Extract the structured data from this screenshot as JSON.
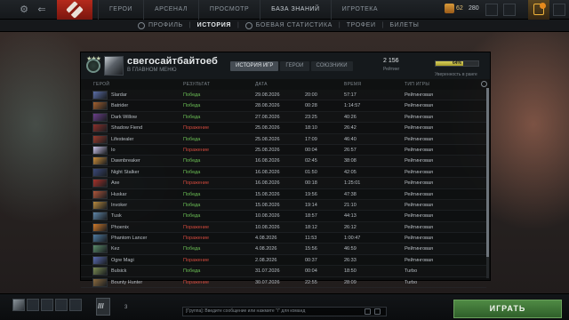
{
  "topbar": {
    "nav": [
      {
        "label": "ГЕРОИ",
        "active": false
      },
      {
        "label": "АРСЕНАЛ",
        "active": false
      },
      {
        "label": "ПРОСМОТР",
        "active": false
      },
      {
        "label": "БАЗА ЗНАНИЙ",
        "active": true
      },
      {
        "label": "ИГРОТЕКА",
        "active": false
      }
    ],
    "shards": "62",
    "level": "280",
    "icons": [
      "gear-icon",
      "back-arrow-icon",
      "dota-logo",
      "treasure-chest-icon",
      "store-icon",
      "notification-icon",
      "ranking-icon",
      "power-icon"
    ]
  },
  "subnav": {
    "items": [
      {
        "label": "ПРОФИЛЬ",
        "active": false
      },
      {
        "label": "ИСТОРИЯ",
        "active": true
      },
      {
        "label": "БОЕВАЯ СТАТИСТИКА",
        "active": false
      },
      {
        "label": "ТРОФЕИ",
        "active": false
      },
      {
        "label": "БИЛЕТЫ",
        "active": false
      }
    ]
  },
  "profile": {
    "name": "свегосайтбайтоеб",
    "status": "В ГЛАВНОМ МЕНЮ",
    "tabs": [
      {
        "label": "ИСТОРИЯ ИГР",
        "active": true
      },
      {
        "label": "ГЕРОИ",
        "active": false
      },
      {
        "label": "СОЮЗНИКИ",
        "active": false
      }
    ],
    "rating_value": "2 156",
    "rating_label": "Рейтинг",
    "winrate_value": "64%",
    "winrate_fraction": 0.64,
    "winrate_label": "Уверенность в ранге"
  },
  "table": {
    "headers": {
      "hero": "ГЕРОЙ",
      "result": "РЕЗУЛЬТАТ",
      "date": "ДАТА",
      "duration": "ВРЕМЯ",
      "type": "ТИП ИГРЫ"
    },
    "rows": [
      {
        "hero": "Slardar",
        "result": "Победа",
        "win": true,
        "date": "29.08.2026",
        "time": "20:00",
        "duration": "57:17",
        "type": "Рейтинговая",
        "color": "#5b6ea8"
      },
      {
        "hero": "Batrider",
        "result": "Победа",
        "win": true,
        "date": "28.08.2026",
        "time": "00:28",
        "duration": "1:14:57",
        "type": "Рейтинговая",
        "color": "#a4602e"
      },
      {
        "hero": "Dark Willow",
        "result": "Победа",
        "win": true,
        "date": "27.08.2026",
        "time": "23:25",
        "duration": "40:26",
        "type": "Рейтинговая",
        "color": "#6b3e8a"
      },
      {
        "hero": "Shadow Fiend",
        "result": "Поражение",
        "win": false,
        "date": "25.08.2026",
        "time": "18:10",
        "duration": "26:42",
        "type": "Рейтинговая",
        "color": "#8b2f2a"
      },
      {
        "hero": "Lifestealer",
        "result": "Победа",
        "win": true,
        "date": "25.08.2026",
        "time": "17:09",
        "duration": "46:40",
        "type": "Рейтинговая",
        "color": "#9a3a2c"
      },
      {
        "hero": "Io",
        "result": "Поражение",
        "win": false,
        "date": "25.08.2026",
        "time": "00:04",
        "duration": "26:57",
        "type": "Рейтинговая",
        "color": "#c9c2e8"
      },
      {
        "hero": "Dawnbreaker",
        "result": "Победа",
        "win": true,
        "date": "16.08.2026",
        "time": "02:45",
        "duration": "38:08",
        "type": "Рейтинговая",
        "color": "#c98d3a"
      },
      {
        "hero": "Night Stalker",
        "result": "Победа",
        "win": true,
        "date": "16.08.2026",
        "time": "01:50",
        "duration": "42:05",
        "type": "Рейтинговая",
        "color": "#3b4a7a"
      },
      {
        "hero": "Axe",
        "result": "Поражение",
        "win": false,
        "date": "16.08.2026",
        "time": "00:18",
        "duration": "1:25:01",
        "type": "Рейтинговая",
        "color": "#a8322a"
      },
      {
        "hero": "Huskar",
        "result": "Победа",
        "win": true,
        "date": "15.08.2026",
        "time": "19:56",
        "duration": "47:38",
        "type": "Рейтинговая",
        "color": "#b0563a"
      },
      {
        "hero": "Invoker",
        "result": "Победа",
        "win": true,
        "date": "15.08.2026",
        "time": "19:14",
        "duration": "21:10",
        "type": "Рейтинговая",
        "color": "#b88a3e"
      },
      {
        "hero": "Tusk",
        "result": "Победа",
        "win": true,
        "date": "10.08.2026",
        "time": "18:57",
        "duration": "44:13",
        "type": "Рейтинговая",
        "color": "#5f86a8"
      },
      {
        "hero": "Phoenix",
        "result": "Поражение",
        "win": false,
        "date": "10.08.2026",
        "time": "18:12",
        "duration": "26:12",
        "type": "Рейтинговая",
        "color": "#d07a2a"
      },
      {
        "hero": "Phantom Lancer",
        "result": "Поражение",
        "win": false,
        "date": "4.08.2026",
        "time": "11:53",
        "duration": "1:00:47",
        "type": "Рейтинговая",
        "color": "#4e7aa0"
      },
      {
        "hero": "Kez",
        "result": "Победа",
        "win": true,
        "date": "4.08.2026",
        "time": "15:56",
        "duration": "46:59",
        "type": "Рейтинговая",
        "color": "#5b8c6a"
      },
      {
        "hero": "Ogre Magi",
        "result": "Поражение",
        "win": false,
        "date": "2.08.2026",
        "time": "00:37",
        "duration": "26:33",
        "type": "Рейтинговая",
        "color": "#5a6bb0"
      },
      {
        "hero": "Bulsick",
        "result": "Победа",
        "win": true,
        "date": "31.07.2026",
        "time": "00:04",
        "duration": "18:50",
        "type": "Turbo",
        "color": "#7a8a52"
      },
      {
        "hero": "Bounty Hunter",
        "result": "Поражение",
        "win": false,
        "date": "30.07.2026",
        "time": "22:55",
        "duration": "28:09",
        "type": "Turbo",
        "color": "#8a6a3e"
      }
    ]
  },
  "bottombar": {
    "queue_count": "3",
    "chat_placeholder": "[Группа]: Введите сообщение или нажмите \"/\" для команд",
    "play_label": "ИГРАТЬ"
  }
}
